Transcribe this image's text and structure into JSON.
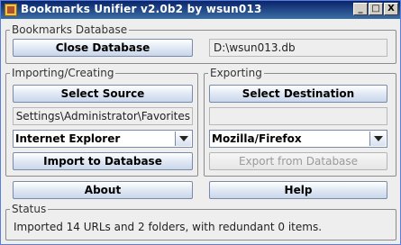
{
  "window": {
    "title": "Bookmarks Unifier v2.0b2 by wsun013",
    "minimize_label": "_",
    "maximize_label": "□",
    "close_label": "X"
  },
  "database": {
    "legend": "Bookmarks Database",
    "close_button": "Close Database",
    "path": "D:\\wsun013.db"
  },
  "importing": {
    "legend": "Importing/Creating",
    "select_button": "Select Source",
    "source_path": "and Settings\\Administrator\\Favorites",
    "browser": "Internet Explorer",
    "import_button": "Import to Database"
  },
  "exporting": {
    "legend": "Exporting",
    "select_button": "Select Destination",
    "destination_path": "",
    "browser": "Mozilla/Firefox",
    "export_button": "Export from Database"
  },
  "buttons": {
    "about": "About",
    "help": "Help"
  },
  "status": {
    "legend": "Status",
    "message": "Imported 14 URLs and 2 folders, with redundant 0 items."
  }
}
